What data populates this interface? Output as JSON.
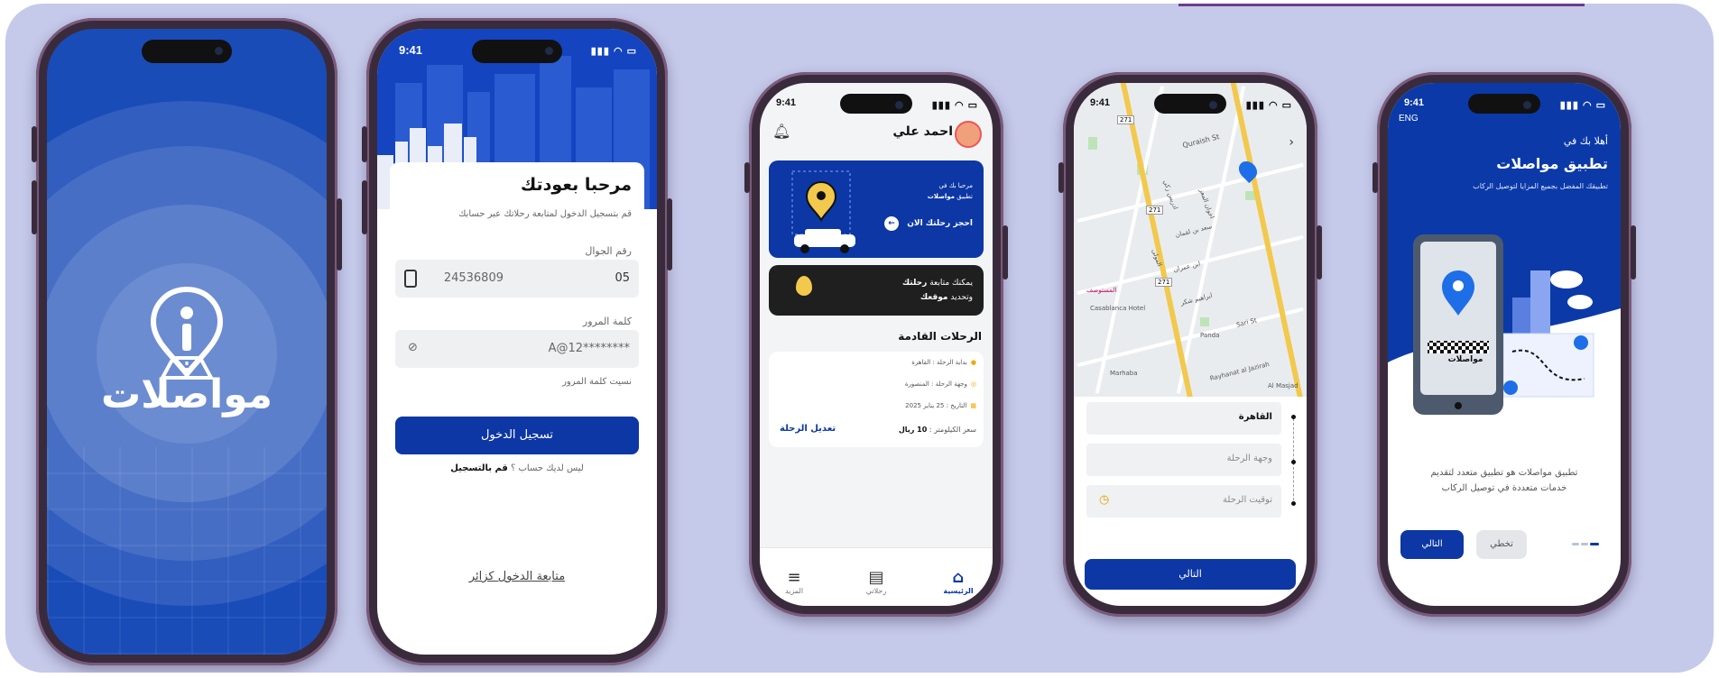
{
  "status_time": "9:41",
  "brand_name": "مواصلات",
  "login": {
    "title": "مرحبا بعودتك",
    "subtitle": "قم بتسجيل الدخول لمتابعة رحلاتك عبر حسابك",
    "phone_label": "رقم الجوال",
    "phone_prefix": "05",
    "phone_value": "24536809",
    "password_label": "كلمة المرور",
    "password_value": "A@12********",
    "forgot": "نسيت كلمة المرور",
    "login_button": "تسجيل الدخول",
    "no_account": "ليس لديك حساب ؟",
    "register": "قم بالتسجيل",
    "guest": "متابعة الدخول كزائر"
  },
  "home": {
    "user_name": "احمد علي",
    "banner_line1": "مرحبا بك في",
    "banner_line2": "تطبيق",
    "banner_line2_bold": "مواصلات",
    "banner_cta": "احجز رحلتك الان",
    "track_line1": "يمكنك متابعة",
    "track_line1_bold": "رحلتك",
    "track_line2": "وتحديد",
    "track_line2_bold": "موقعك",
    "upcoming_title": "الرحلات القادمة",
    "trip_start": "بداية الرحلة : القاهرة",
    "trip_dest": "وجهة الرحلة : المنصورة",
    "trip_date": "التاريخ : 25 يناير 2025",
    "price_label": "سعر الكيلومتر :",
    "price_value": "10 ريال",
    "edit_trip": "تعديل الرحلة",
    "tabs": [
      "الرئيسية",
      "رحلاتي",
      "المزيد"
    ]
  },
  "map_screen": {
    "streets": [
      "Quraish St",
      "Casablanca Hotel",
      "Panda",
      "Sari St",
      "Marhaba",
      "Rayhanat al Jazirah",
      "Al Masjad",
      "ادريس زكي",
      "سعد بن لقمان",
      "اخوان المعز",
      "المولى",
      "ابراهيم شكر",
      "ابن عمران",
      "المستوصف"
    ],
    "route_badges": [
      "271",
      "271",
      "271"
    ],
    "origin_value": "القاهرة",
    "dest_placeholder": "وجهة الرحلة",
    "time_placeholder": "توقيت الرحلة",
    "next_button": "التالي"
  },
  "onboarding": {
    "lang": "ENG",
    "welcome": "أهلا بك في",
    "title": "تطبيق مواصلات",
    "subtitle": "تطبيقك المفضل بجميع المزايا لتوصيل الركاب",
    "illus_label": "مواصلات",
    "desc_line1": "تطبيق مواصلات هو تطبيق متعدد لتقديم",
    "desc_line2": "خدمات متعددة في توصيل الركاب",
    "next_button": "التالي",
    "skip_button": "تخطي"
  },
  "colors": {
    "brand_blue": "#0c37a4",
    "background": "#c5c9ea",
    "accent_yellow": "#f2c94c"
  }
}
